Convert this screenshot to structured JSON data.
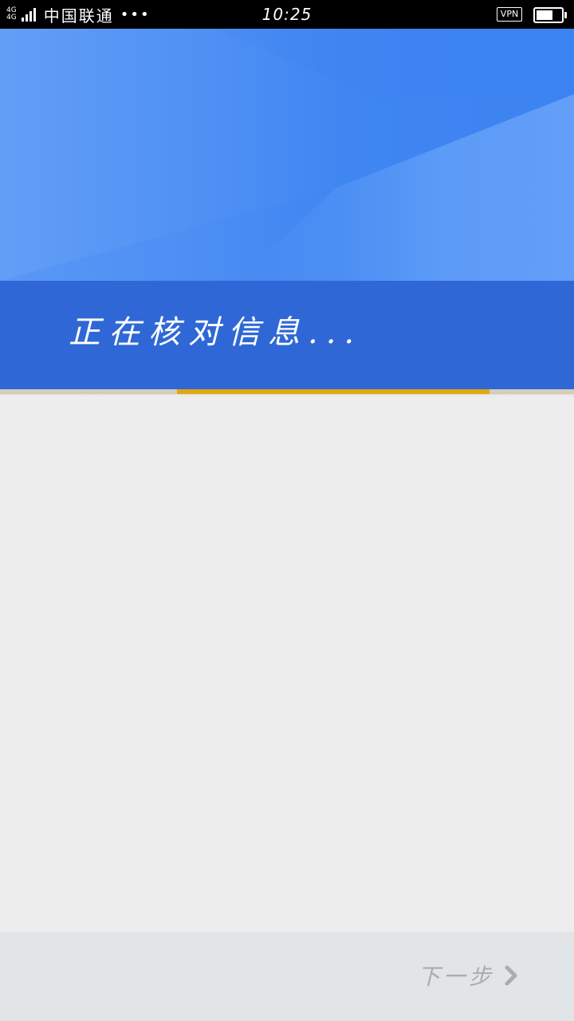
{
  "status_bar": {
    "network_top": "4G",
    "network_bottom": "4G",
    "carrier": "中国联通",
    "more": "•••",
    "time": "10:25",
    "vpn": "VPN",
    "battery_level": 0.6
  },
  "main": {
    "status_text": "正在核对信息...",
    "progress": {
      "start": 0.308,
      "end": 0.853
    }
  },
  "footer": {
    "next_label": "下一步",
    "next_icon": "chevron-right-icon"
  },
  "colors": {
    "banner_blue": "#3f86f2",
    "panel_blue": "#2f68d6",
    "progress_accent": "#e0a614",
    "background": "#ededed",
    "footer_bg": "#e1e5e8",
    "disabled_text": "#a9acb0"
  }
}
